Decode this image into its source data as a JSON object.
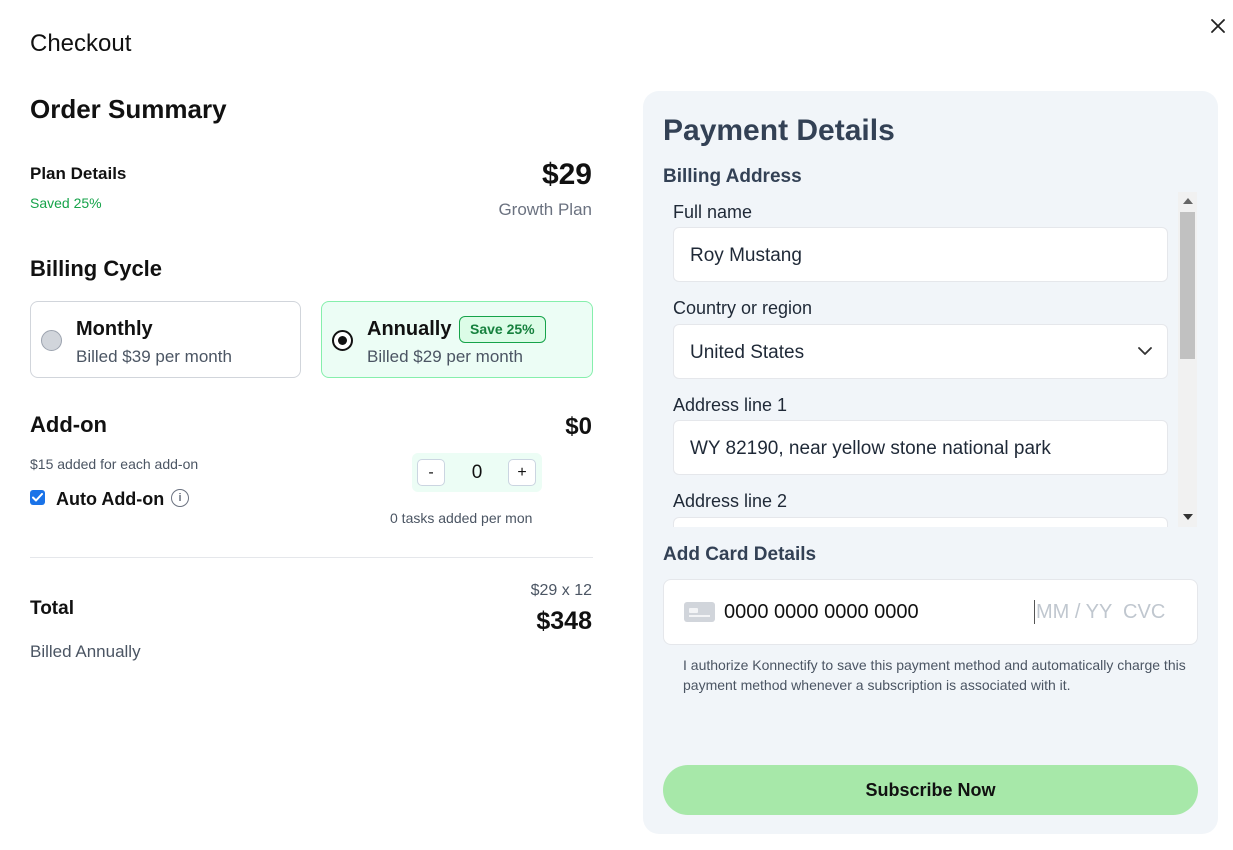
{
  "header": {
    "title": "Checkout",
    "close_icon": "close-icon"
  },
  "order": {
    "title": "Order Summary",
    "plan_label": "Plan Details",
    "saved_text": "Saved 25%",
    "plan_price": "$29",
    "plan_name": "Growth Plan"
  },
  "billing_cycle": {
    "title": "Billing Cycle",
    "options": [
      {
        "name": "Monthly",
        "sub": "Billed $39 per month",
        "selected": false
      },
      {
        "name": "Annually",
        "sub": "Billed $29 per month",
        "badge": "Save 25%",
        "selected": true
      }
    ]
  },
  "addon": {
    "title": "Add-on",
    "price": "$0",
    "note": "$15 added for each add-on",
    "minus_label": "-",
    "plus_label": "+",
    "quantity": "0",
    "tasks_note": "0 tasks added per mon",
    "auto_label": "Auto Add-on",
    "auto_checked": true,
    "info_icon": "i"
  },
  "total": {
    "label": "Total",
    "calc": "$29 x 12",
    "price": "$348",
    "billed": "Billed Annually"
  },
  "payment": {
    "title": "Payment Details",
    "billing_address_title": "Billing Address",
    "fields": {
      "full_name_label": "Full name",
      "full_name_value": "Roy Mustang",
      "country_label": "Country or region",
      "country_value": "United States",
      "address1_label": "Address line 1",
      "address1_value": "WY 82190, near yellow stone national park",
      "address2_label": "Address line 2",
      "address2_value": ""
    },
    "card_title": "Add Card Details",
    "card_number": "0000 0000 0000 0000",
    "card_exp_cvc": "MM / YY  CVC",
    "authorize_text": "I authorize Konnectify to save this payment method and automatically charge this payment method whenever a subscription is associated with it.",
    "subscribe_label": "Subscribe Now"
  },
  "colors": {
    "accent_green": "#16a34a",
    "subscribe_bg": "#a7e8a9",
    "panel_bg": "#f1f5f9",
    "checkbox_blue": "#1a73e8"
  }
}
